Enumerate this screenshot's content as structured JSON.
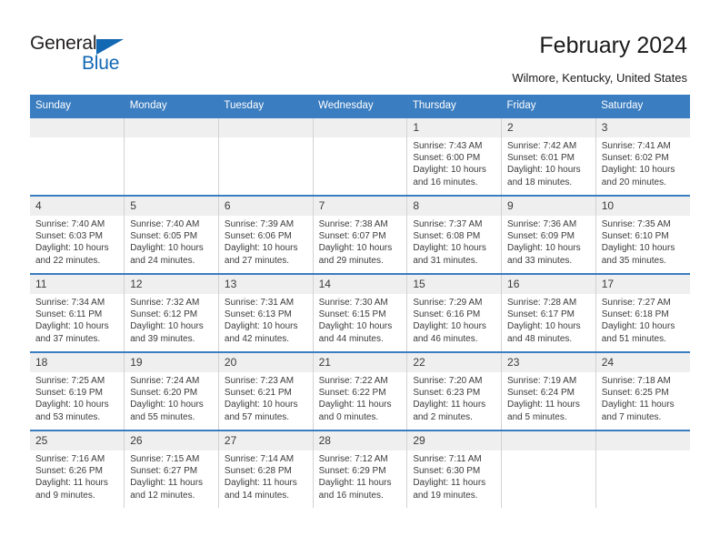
{
  "brand": {
    "name_part1": "General",
    "name_part2": "Blue",
    "triangle_color": "#1268b3",
    "text_color": "#231f20"
  },
  "header": {
    "title": "February 2024",
    "subtitle": "Wilmore, Kentucky, United States",
    "header_bg": "#3a7dc0"
  },
  "weekdays": [
    "Sunday",
    "Monday",
    "Tuesday",
    "Wednesday",
    "Thursday",
    "Friday",
    "Saturday"
  ],
  "labels": {
    "sunrise": "Sunrise:",
    "sunset": "Sunset:",
    "daylight": "Daylight:"
  },
  "weeks": [
    [
      {
        "day": "",
        "blank": true
      },
      {
        "day": "",
        "blank": true
      },
      {
        "day": "",
        "blank": true
      },
      {
        "day": "",
        "blank": true
      },
      {
        "day": "1",
        "sunrise": "Sunrise: 7:43 AM",
        "sunset": "Sunset: 6:00 PM",
        "daylight_l1": "Daylight: 10 hours",
        "daylight_l2": "and 16 minutes."
      },
      {
        "day": "2",
        "sunrise": "Sunrise: 7:42 AM",
        "sunset": "Sunset: 6:01 PM",
        "daylight_l1": "Daylight: 10 hours",
        "daylight_l2": "and 18 minutes."
      },
      {
        "day": "3",
        "sunrise": "Sunrise: 7:41 AM",
        "sunset": "Sunset: 6:02 PM",
        "daylight_l1": "Daylight: 10 hours",
        "daylight_l2": "and 20 minutes."
      }
    ],
    [
      {
        "day": "4",
        "sunrise": "Sunrise: 7:40 AM",
        "sunset": "Sunset: 6:03 PM",
        "daylight_l1": "Daylight: 10 hours",
        "daylight_l2": "and 22 minutes."
      },
      {
        "day": "5",
        "sunrise": "Sunrise: 7:40 AM",
        "sunset": "Sunset: 6:05 PM",
        "daylight_l1": "Daylight: 10 hours",
        "daylight_l2": "and 24 minutes."
      },
      {
        "day": "6",
        "sunrise": "Sunrise: 7:39 AM",
        "sunset": "Sunset: 6:06 PM",
        "daylight_l1": "Daylight: 10 hours",
        "daylight_l2": "and 27 minutes."
      },
      {
        "day": "7",
        "sunrise": "Sunrise: 7:38 AM",
        "sunset": "Sunset: 6:07 PM",
        "daylight_l1": "Daylight: 10 hours",
        "daylight_l2": "and 29 minutes."
      },
      {
        "day": "8",
        "sunrise": "Sunrise: 7:37 AM",
        "sunset": "Sunset: 6:08 PM",
        "daylight_l1": "Daylight: 10 hours",
        "daylight_l2": "and 31 minutes."
      },
      {
        "day": "9",
        "sunrise": "Sunrise: 7:36 AM",
        "sunset": "Sunset: 6:09 PM",
        "daylight_l1": "Daylight: 10 hours",
        "daylight_l2": "and 33 minutes."
      },
      {
        "day": "10",
        "sunrise": "Sunrise: 7:35 AM",
        "sunset": "Sunset: 6:10 PM",
        "daylight_l1": "Daylight: 10 hours",
        "daylight_l2": "and 35 minutes."
      }
    ],
    [
      {
        "day": "11",
        "sunrise": "Sunrise: 7:34 AM",
        "sunset": "Sunset: 6:11 PM",
        "daylight_l1": "Daylight: 10 hours",
        "daylight_l2": "and 37 minutes."
      },
      {
        "day": "12",
        "sunrise": "Sunrise: 7:32 AM",
        "sunset": "Sunset: 6:12 PM",
        "daylight_l1": "Daylight: 10 hours",
        "daylight_l2": "and 39 minutes."
      },
      {
        "day": "13",
        "sunrise": "Sunrise: 7:31 AM",
        "sunset": "Sunset: 6:13 PM",
        "daylight_l1": "Daylight: 10 hours",
        "daylight_l2": "and 42 minutes."
      },
      {
        "day": "14",
        "sunrise": "Sunrise: 7:30 AM",
        "sunset": "Sunset: 6:15 PM",
        "daylight_l1": "Daylight: 10 hours",
        "daylight_l2": "and 44 minutes."
      },
      {
        "day": "15",
        "sunrise": "Sunrise: 7:29 AM",
        "sunset": "Sunset: 6:16 PM",
        "daylight_l1": "Daylight: 10 hours",
        "daylight_l2": "and 46 minutes."
      },
      {
        "day": "16",
        "sunrise": "Sunrise: 7:28 AM",
        "sunset": "Sunset: 6:17 PM",
        "daylight_l1": "Daylight: 10 hours",
        "daylight_l2": "and 48 minutes."
      },
      {
        "day": "17",
        "sunrise": "Sunrise: 7:27 AM",
        "sunset": "Sunset: 6:18 PM",
        "daylight_l1": "Daylight: 10 hours",
        "daylight_l2": "and 51 minutes."
      }
    ],
    [
      {
        "day": "18",
        "sunrise": "Sunrise: 7:25 AM",
        "sunset": "Sunset: 6:19 PM",
        "daylight_l1": "Daylight: 10 hours",
        "daylight_l2": "and 53 minutes."
      },
      {
        "day": "19",
        "sunrise": "Sunrise: 7:24 AM",
        "sunset": "Sunset: 6:20 PM",
        "daylight_l1": "Daylight: 10 hours",
        "daylight_l2": "and 55 minutes."
      },
      {
        "day": "20",
        "sunrise": "Sunrise: 7:23 AM",
        "sunset": "Sunset: 6:21 PM",
        "daylight_l1": "Daylight: 10 hours",
        "daylight_l2": "and 57 minutes."
      },
      {
        "day": "21",
        "sunrise": "Sunrise: 7:22 AM",
        "sunset": "Sunset: 6:22 PM",
        "daylight_l1": "Daylight: 11 hours",
        "daylight_l2": "and 0 minutes."
      },
      {
        "day": "22",
        "sunrise": "Sunrise: 7:20 AM",
        "sunset": "Sunset: 6:23 PM",
        "daylight_l1": "Daylight: 11 hours",
        "daylight_l2": "and 2 minutes."
      },
      {
        "day": "23",
        "sunrise": "Sunrise: 7:19 AM",
        "sunset": "Sunset: 6:24 PM",
        "daylight_l1": "Daylight: 11 hours",
        "daylight_l2": "and 5 minutes."
      },
      {
        "day": "24",
        "sunrise": "Sunrise: 7:18 AM",
        "sunset": "Sunset: 6:25 PM",
        "daylight_l1": "Daylight: 11 hours",
        "daylight_l2": "and 7 minutes."
      }
    ],
    [
      {
        "day": "25",
        "sunrise": "Sunrise: 7:16 AM",
        "sunset": "Sunset: 6:26 PM",
        "daylight_l1": "Daylight: 11 hours",
        "daylight_l2": "and 9 minutes."
      },
      {
        "day": "26",
        "sunrise": "Sunrise: 7:15 AM",
        "sunset": "Sunset: 6:27 PM",
        "daylight_l1": "Daylight: 11 hours",
        "daylight_l2": "and 12 minutes."
      },
      {
        "day": "27",
        "sunrise": "Sunrise: 7:14 AM",
        "sunset": "Sunset: 6:28 PM",
        "daylight_l1": "Daylight: 11 hours",
        "daylight_l2": "and 14 minutes."
      },
      {
        "day": "28",
        "sunrise": "Sunrise: 7:12 AM",
        "sunset": "Sunset: 6:29 PM",
        "daylight_l1": "Daylight: 11 hours",
        "daylight_l2": "and 16 minutes."
      },
      {
        "day": "29",
        "sunrise": "Sunrise: 7:11 AM",
        "sunset": "Sunset: 6:30 PM",
        "daylight_l1": "Daylight: 11 hours",
        "daylight_l2": "and 19 minutes."
      },
      {
        "day": "",
        "blank": true
      },
      {
        "day": "",
        "blank": true
      }
    ]
  ]
}
